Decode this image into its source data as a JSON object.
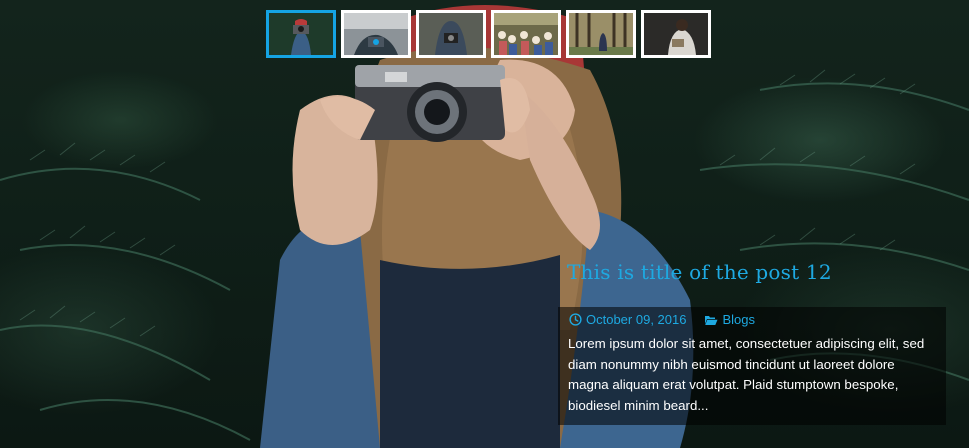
{
  "slider": {
    "thumbnails": [
      {
        "name": "thumb-girl-camera",
        "active": true
      },
      {
        "name": "thumb-camera-street",
        "active": false
      },
      {
        "name": "thumb-man-camera",
        "active": false
      },
      {
        "name": "thumb-crowd",
        "active": false
      },
      {
        "name": "thumb-forest-walk",
        "active": false
      },
      {
        "name": "thumb-woman-reading",
        "active": false
      }
    ]
  },
  "post": {
    "title": "This is title of the post 12",
    "date": "October 09, 2016",
    "category": "Blogs",
    "excerpt": "Lorem ipsum dolor sit amet, consectetuer adipiscing elit, sed diam nonummy nibh euismod tincidunt ut laoreet dolore magna aliquam erat volutpat. Plaid stumptown bespoke, biodiesel minim beard..."
  },
  "icons": {
    "date": "clock-icon",
    "category": "folder-open-icon"
  },
  "colors": {
    "accent": "#1ea9e1",
    "thumb_active_border": "#15a4e4",
    "thumb_border": "#ffffff",
    "caption_background": "rgba(0,0,0,0.55)"
  }
}
